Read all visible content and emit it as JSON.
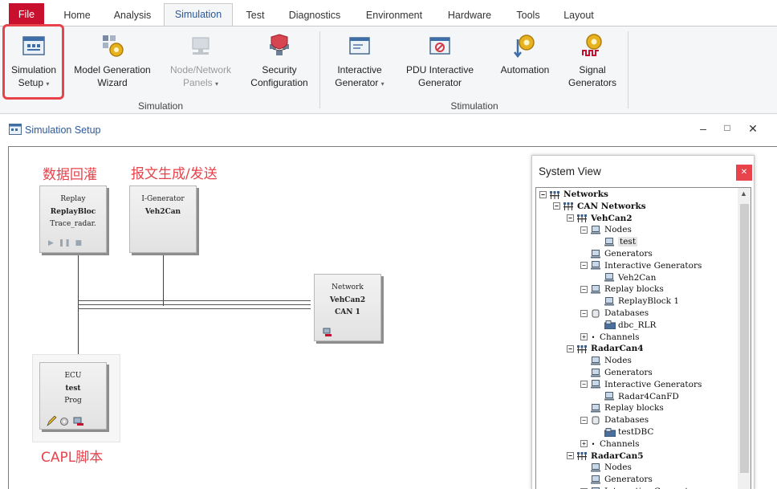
{
  "ribbon": {
    "tabs": [
      {
        "label": "File"
      },
      {
        "label": "Home"
      },
      {
        "label": "Analysis"
      },
      {
        "label": "Simulation"
      },
      {
        "label": "Test"
      },
      {
        "label": "Diagnostics"
      },
      {
        "label": "Environment"
      },
      {
        "label": "Hardware"
      },
      {
        "label": "Tools"
      },
      {
        "label": "Layout"
      }
    ],
    "active_tab": "Simulation",
    "buttons": {
      "simulation_setup": {
        "line1": "Simulation",
        "line2": "Setup"
      },
      "model_generation_wizard": {
        "line1": "Model Generation",
        "line2": "Wizard"
      },
      "node_network_panels": {
        "line1": "Node/Network",
        "line2": "Panels"
      },
      "security_configuration": {
        "line1": "Security",
        "line2": "Configuration"
      },
      "interactive_generator": {
        "line1": "Interactive",
        "line2": "Generator"
      },
      "pdu_interactive_generator": {
        "line1": "PDU Interactive",
        "line2": "Generator"
      },
      "automation": {
        "line1": "Automation",
        "line2": ""
      },
      "signal_generators": {
        "line1": "Signal",
        "line2": "Generators"
      }
    },
    "groups": {
      "simulation": "Simulation",
      "stimulation": "Stimulation"
    }
  },
  "window": {
    "title": "Simulation Setup",
    "controls": {
      "minimize": "–",
      "maximize": "□",
      "close": "✕"
    }
  },
  "annotations": {
    "replay": "数据回灌",
    "generator": "报文生成/发送",
    "capl": "CAPL脚本"
  },
  "blocks": {
    "replay": {
      "line1": "Replay",
      "line2": "ReplayBloc",
      "line3": "Trace_radar."
    },
    "igen": {
      "line1": "I-Generator",
      "line2": "Veh2Can"
    },
    "network": {
      "line1": "Network",
      "line2": "VehCan2",
      "line3": "CAN 1"
    },
    "ecu": {
      "line1": "ECU",
      "line2": "test",
      "line3": "Prog"
    }
  },
  "system_view": {
    "title": "System View",
    "close_glyph": "✕",
    "tree": [
      {
        "label": "Networks",
        "exp": "−",
        "icon": "net",
        "bold": true
      },
      {
        "label": "CAN Networks",
        "exp": "−",
        "icon": "net",
        "bold": true
      },
      {
        "label": "VehCan2",
        "exp": "−",
        "icon": "net",
        "bold": true
      },
      {
        "label": "Nodes",
        "exp": "−",
        "icon": "node"
      },
      {
        "label": "test",
        "exp": "",
        "icon": "node",
        "selected": true
      },
      {
        "label": "Generators",
        "exp": "",
        "icon": "node"
      },
      {
        "label": "Interactive Generators",
        "exp": "−",
        "icon": "node"
      },
      {
        "label": "Veh2Can",
        "exp": "",
        "icon": "node"
      },
      {
        "label": "Replay blocks",
        "exp": "−",
        "icon": "node"
      },
      {
        "label": "ReplayBlock 1",
        "exp": "",
        "icon": "node"
      },
      {
        "label": "Databases",
        "exp": "−",
        "icon": "db"
      },
      {
        "label": "dbc_RLR",
        "exp": "",
        "icon": "dbc"
      },
      {
        "label": "Channels",
        "exp": "+",
        "icon": "ch"
      },
      {
        "label": "RadarCan4",
        "exp": "−",
        "icon": "net",
        "bold": true
      },
      {
        "label": "Nodes",
        "exp": "",
        "icon": "node"
      },
      {
        "label": "Generators",
        "exp": "",
        "icon": "node"
      },
      {
        "label": "Interactive Generators",
        "exp": "−",
        "icon": "node"
      },
      {
        "label": "Radar4CanFD",
        "exp": "",
        "icon": "node"
      },
      {
        "label": "Replay blocks",
        "exp": "",
        "icon": "node"
      },
      {
        "label": "Databases",
        "exp": "−",
        "icon": "db"
      },
      {
        "label": "testDBC",
        "exp": "",
        "icon": "dbc"
      },
      {
        "label": "Channels",
        "exp": "+",
        "icon": "ch"
      },
      {
        "label": "RadarCan5",
        "exp": "−",
        "icon": "net",
        "bold": true
      },
      {
        "label": "Nodes",
        "exp": "",
        "icon": "node"
      },
      {
        "label": "Generators",
        "exp": "",
        "icon": "node"
      },
      {
        "label": "Interactive Generators",
        "exp": "+",
        "icon": "node"
      }
    ]
  },
  "colors": {
    "accent": "#e8424b",
    "tab_active": "#2b5797",
    "file_tab": "#c8102e"
  }
}
